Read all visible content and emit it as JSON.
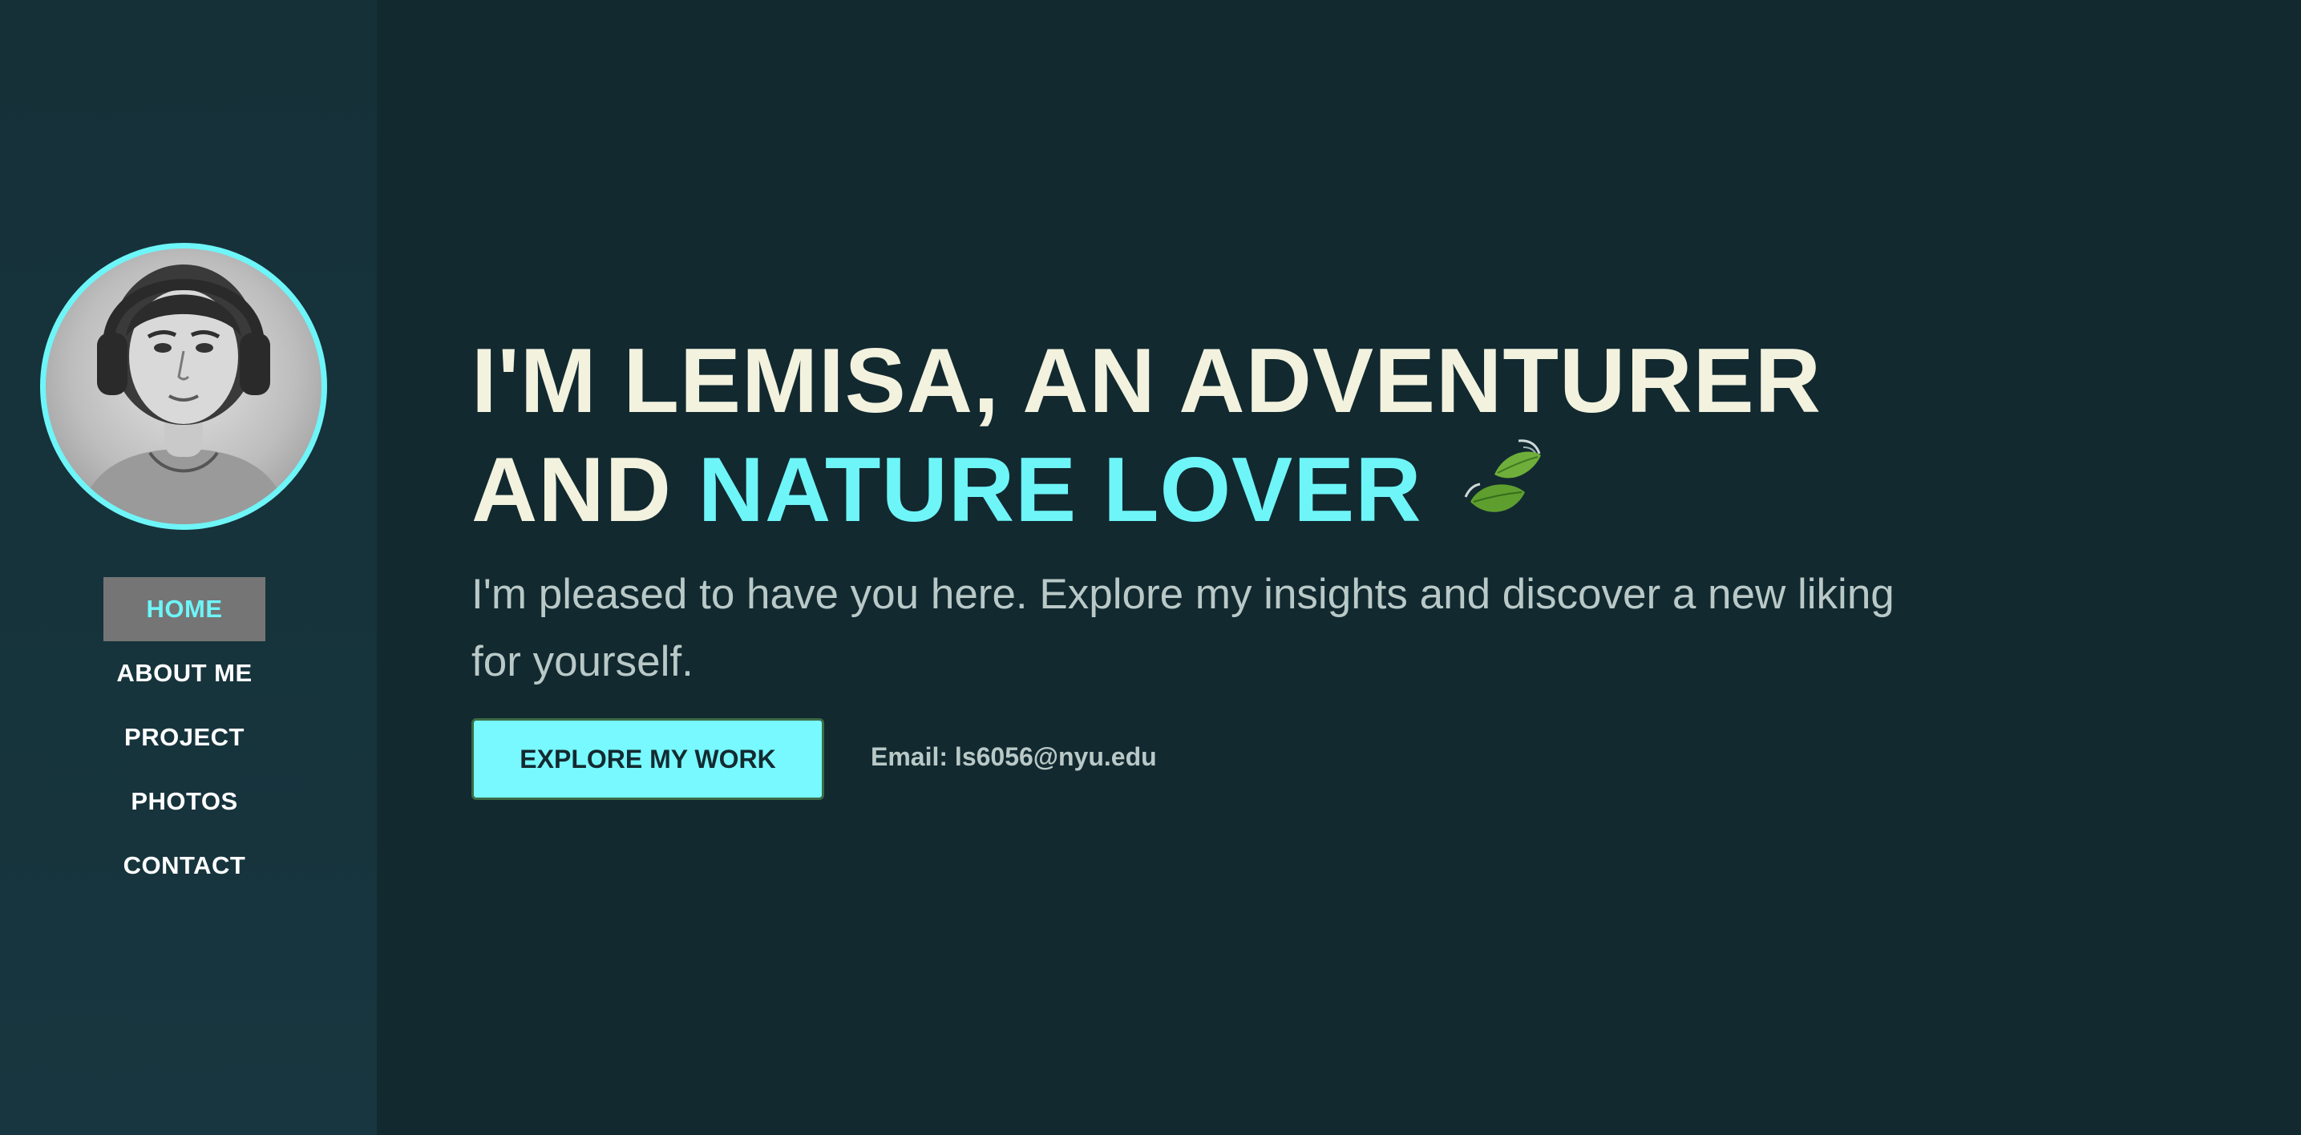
{
  "sidebar": {
    "avatar_alt": "Portrait of Lemisa",
    "nav": [
      {
        "label": "HOME",
        "active": true
      },
      {
        "label": "ABOUT ME",
        "active": false
      },
      {
        "label": "PROJECT",
        "active": false
      },
      {
        "label": "PHOTOS",
        "active": false
      },
      {
        "label": "CONTACT",
        "active": false
      }
    ]
  },
  "hero": {
    "line1": "I'M LEMISA, AN ADVENTURER",
    "line2_prefix": "AND ",
    "line2_accent": "NATURE LOVER",
    "leaf_icon": "leaf-fluttering-in-wind-icon",
    "subtitle": "I'm pleased to have you here. Explore my insights and discover a new liking for yourself.",
    "cta_label": "EXPLORE MY WORK",
    "email": "Email: ls6056@nyu.edu"
  },
  "colors": {
    "background": "#122930",
    "sidebar": "#163038",
    "accent": "#6ef5f8",
    "headline": "#f2f2de",
    "body_text": "#b9c9c7",
    "active_nav_bg": "#757575"
  }
}
